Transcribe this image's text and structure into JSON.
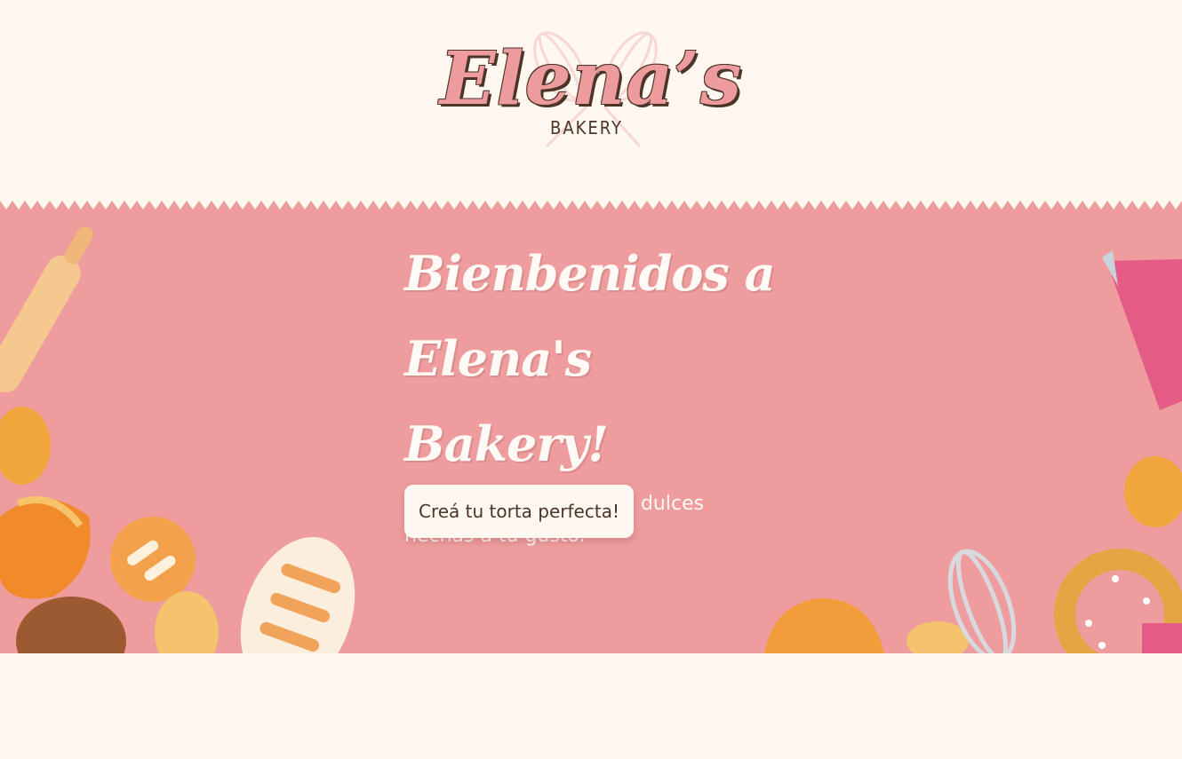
{
  "brand": {
    "name": "Elena’s",
    "tagline": "BAKERY"
  },
  "hero": {
    "title_line1": "Bienbenidos a",
    "title_line2": "Elena's Bakery!",
    "subtitle": "Tu destino para delicias dulces hechas a tu gusto.",
    "cta_label": "Creá tu torta perfecta!"
  },
  "colors": {
    "background": "#fff8f0",
    "hero": "#ee9c9e",
    "text_dark": "#4a3528",
    "text_light": "#fffaf5"
  },
  "decorations": [
    "rolling-pin-icon",
    "croissant-icon",
    "bread-roll-icon",
    "baguette-icon",
    "piping-bag-icon",
    "whisk-icon",
    "pretzel-icon"
  ]
}
